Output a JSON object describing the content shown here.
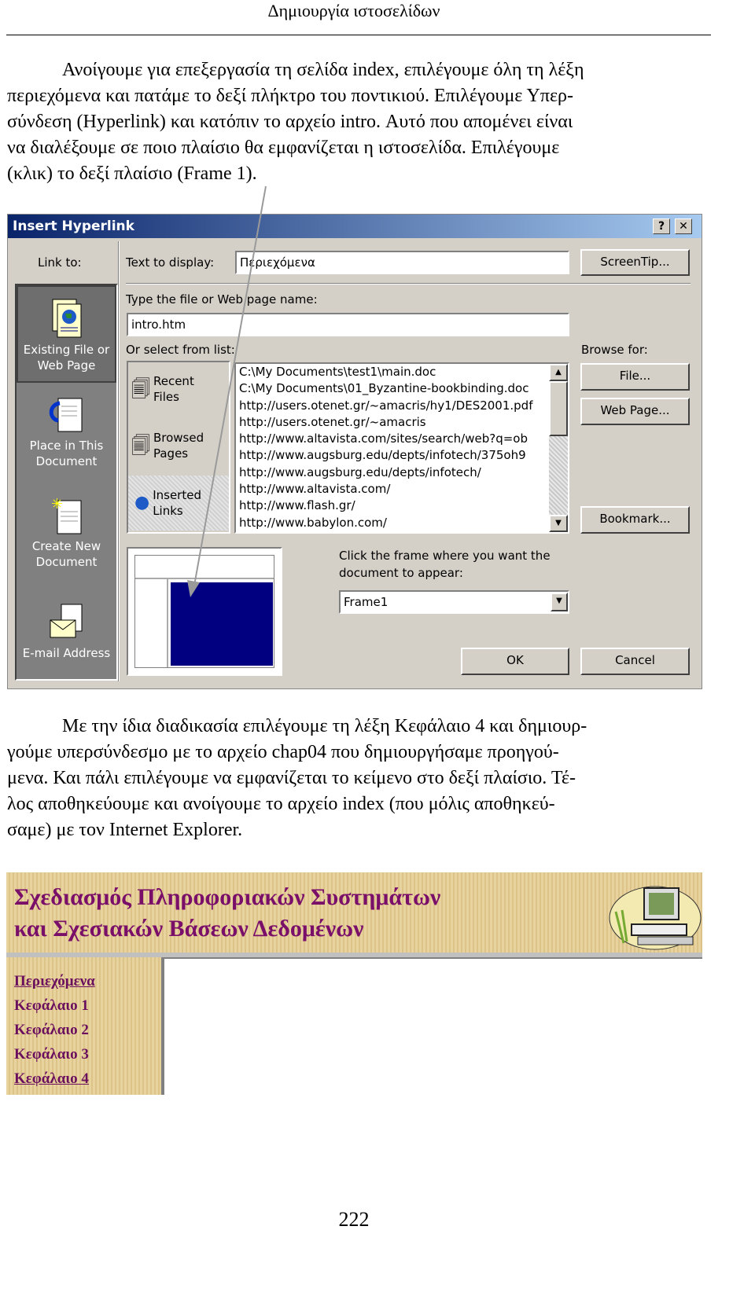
{
  "header": "Δημιουργία ιστοσελίδων",
  "para1": [
    "Ανοίγουμε για επεξεργασία τη σελίδα index, επιλέγουμε όλη τη λέξη",
    "περιεχόμενα και πατάμε το δεξί πλήκτρο του ποντικιού. Επιλέγουμε Υπερ-",
    "σύνδεση (Hyperlink) και κατόπιν το αρχείο intro. Αυτό που απομένει είναι",
    "να διαλέξουμε σε ποιο πλαίσιο θα εμφανίζεται η ιστοσελίδα. Επιλέγουμε",
    "(κλικ) το δεξί πλαίσιο (Frame 1)."
  ],
  "dialog": {
    "title": "Insert Hyperlink",
    "help": "?",
    "close": "✕",
    "link_to": "Link to:",
    "link_items": [
      "Existing File or",
      "Web Page",
      "Place in This",
      "Document",
      "Create New",
      "Document",
      "E-mail Address"
    ],
    "text_to_display_label": "Text to display:",
    "text_to_display_value": "Περιεχόμενα",
    "screentip": "ScreenTip...",
    "file_label": "Type the file or Web page name:",
    "file_value": "intro.htm",
    "or_select": "Or select from list:",
    "browse_for": "Browse for:",
    "sub_items": [
      "Recent",
      "Files",
      "Browsed",
      "Pages",
      "Inserted",
      "Links"
    ],
    "list": [
      "C:\\My Documents\\test1\\main.doc",
      "C:\\My Documents\\01_Byzantine-bookbinding.doc",
      "http://users.otenet.gr/~amacris/hy1/DES2001.pdf",
      "http://users.otenet.gr/~amacris",
      "http://www.altavista.com/sites/search/web?q=ob",
      "http://www.augsburg.edu/depts/infotech/375oh9",
      "http://www.augsburg.edu/depts/infotech/",
      "http://www.altavista.com/",
      "http://www.flash.gr/",
      "http://www.babylon.com/"
    ],
    "file_btn": "File...",
    "webpage_btn": "Web Page...",
    "bookmark_btn": "Bookmark...",
    "frame_prompt": [
      "Click the frame where you want the",
      "document to appear:"
    ],
    "frame_value": "Frame1",
    "ok": "OK",
    "cancel": "Cancel",
    "colors": {
      "title_bar": "#0a246a",
      "selected_frame": "#000080"
    }
  },
  "para2": [
    "Με την ίδια διαδικασία επιλέγουμε τη λέξη Κεφάλαιο 4 και δημιουρ-",
    "γούμε υπερσύνδεσμο με το αρχείο chap04 που δημιουργήσαμε προηγού-",
    "μενα. Και πάλι επιλέγουμε να εμφανίζεται το κείμενο στο δεξί πλαίσιο. Τέ-",
    "λος αποθηκεύουμε και ανοίγουμε το αρχείο index (που μόλις αποθηκεύ-",
    "σαμε) με τον Internet Explorer."
  ],
  "web": {
    "title": [
      "Σχεδιασμός Πληροφοριακών Συστημάτων",
      "και Σχεσιακών Βάσεων Δεδομένων"
    ],
    "links": [
      "Περιεχόμενα",
      "Κεφάλαιο 1",
      "Κεφάλαιο 2",
      "Κεφάλαιο 3",
      "Κεφάλαιο 4"
    ],
    "colors": {
      "text": "#7a0f6a",
      "background": "#e4cd96"
    }
  },
  "page_number": "222"
}
